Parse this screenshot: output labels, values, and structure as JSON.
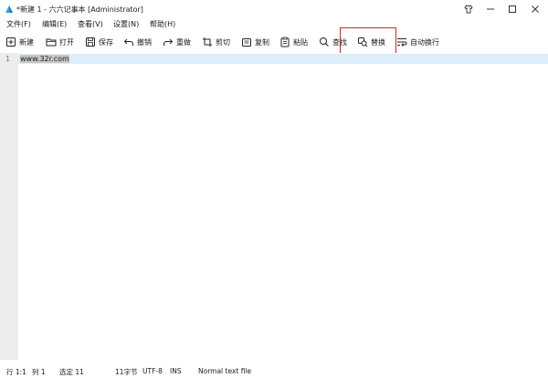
{
  "window": {
    "title": "*新建 1 - 六六记事本 [Administrator]"
  },
  "menu": [
    {
      "label": "文件(F)"
    },
    {
      "label": "编辑(E)"
    },
    {
      "label": "查看(V)"
    },
    {
      "label": "设置(N)"
    },
    {
      "label": "帮助(H)"
    }
  ],
  "toolbar": {
    "new_label": "新建",
    "open_label": "打开",
    "save_label": "保存",
    "undo_label": "撤销",
    "redo_label": "重做",
    "cut_label": "剪切",
    "copy_label": "复制",
    "paste_label": "粘贴",
    "find_label": "查找",
    "replace_label": "替换",
    "wrap_label": "自动换行"
  },
  "editor": {
    "line_number": "1",
    "content": "www.32r.com"
  },
  "status": {
    "position": "行 1:1",
    "column": "列 1",
    "selection": "选定 11",
    "bytes": "11字节",
    "encoding": "UTF-8",
    "mode": "INS",
    "file_type": "Normal text file"
  },
  "colors": {
    "highlight_border": "#d9261c",
    "current_line": "#ddeefa",
    "gutter": "#ececec"
  }
}
